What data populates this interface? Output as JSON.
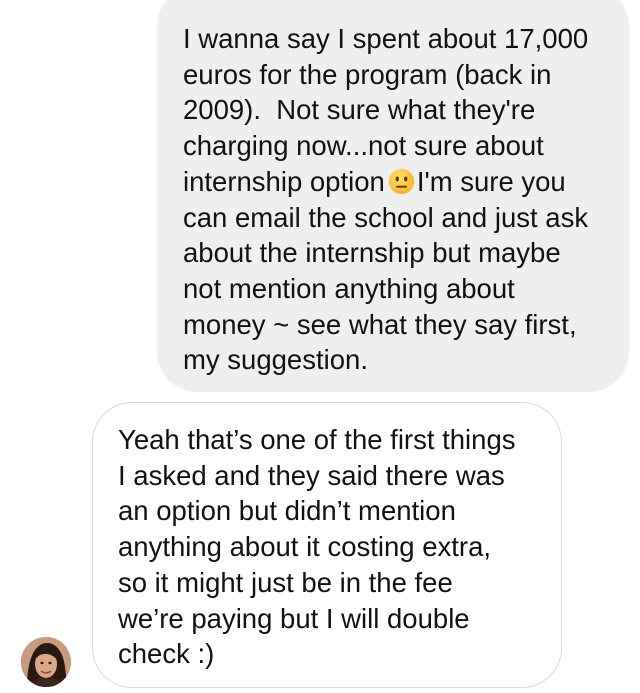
{
  "conversation": {
    "sent_message": {
      "lines": [
        "I wanna say I spent about 17,000",
        "euros for the program (back in",
        "2009).  Not sure what they're",
        "charging now...not sure about",
        "internship option",
        "I'm sure you",
        "can email the school and just ask",
        "about the internship but maybe",
        "not mention anything about",
        "money ~ see what they say first,",
        "my suggestion."
      ],
      "emoji": "neutral-face-icon"
    },
    "received_message": {
      "lines": [
        "Yeah that’s one of the first things",
        "I asked and they said there was",
        "an option but didn’t mention",
        "anything about it costing extra,",
        "so it might just be in the fee",
        "we’re paying but I will double",
        "check :)"
      ]
    },
    "avatar": "profile-photo"
  },
  "colors": {
    "sent_bubble": "#efefef",
    "received_bubble_border": "#dadada",
    "text": "#111111",
    "emoji": "#fcc936"
  }
}
